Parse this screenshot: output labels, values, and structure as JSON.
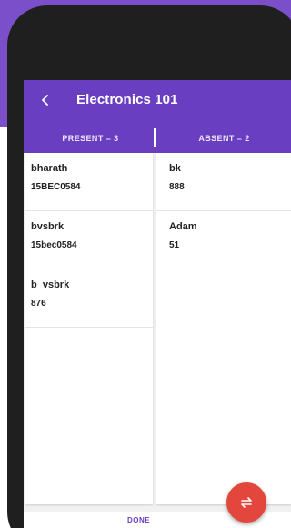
{
  "appbar": {
    "title": "Electronics 101",
    "back_icon": "chevron-left-icon",
    "color": "#6a3ec0"
  },
  "tabs": {
    "present_label": "PRESENT = 3",
    "absent_label": "ABSENT = 2"
  },
  "present": [
    {
      "name": "bharath",
      "roll": "15BEC0584"
    },
    {
      "name": "bvsbrk",
      "roll": "15bec0584"
    },
    {
      "name": "b_vsbrk",
      "roll": "876"
    }
  ],
  "absent": [
    {
      "name": "bk",
      "roll": "888"
    },
    {
      "name": "Adam",
      "roll": "51"
    }
  ],
  "footer": {
    "done_label": "DONE"
  },
  "fab": {
    "icon": "swap-arrows-icon",
    "color": "#e2463c"
  }
}
